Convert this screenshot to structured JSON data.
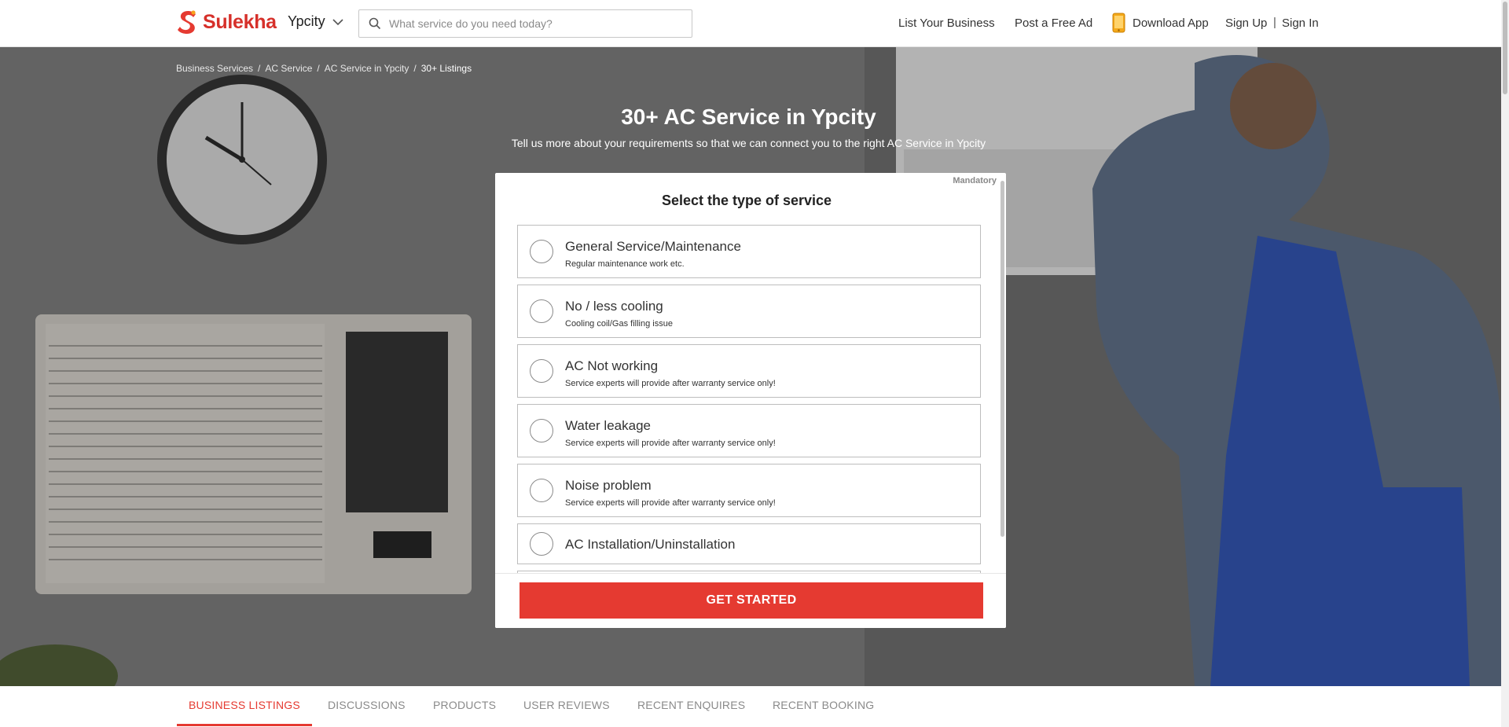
{
  "brand": {
    "name": "Sulekha",
    "accent": "#e53a31"
  },
  "header": {
    "city": "Ypcity",
    "search_placeholder": "What service do you need today?",
    "links": {
      "list_business": "List Your Business",
      "post_ad": "Post a Free Ad",
      "download_app": "Download App",
      "sign_up": "Sign Up",
      "separator": "|",
      "sign_in": "Sign In"
    }
  },
  "breadcrumb": [
    {
      "label": "Business Services"
    },
    {
      "label": "AC Service"
    },
    {
      "label": "AC Service in Ypcity"
    },
    {
      "label": "30+ Listings"
    }
  ],
  "breadcrumb_sep": "/",
  "hero": {
    "title": "30+ AC Service in Ypcity",
    "subtitle": "Tell us more about your requirements so that we can connect you to the right AC Service in Ypcity"
  },
  "form": {
    "mandatory": "Mandatory",
    "title": "Select the type of service",
    "options": [
      {
        "label": "General Service/Maintenance",
        "desc": "Regular maintenance work etc."
      },
      {
        "label": "No / less cooling",
        "desc": "Cooling coil/Gas filling issue"
      },
      {
        "label": "AC Not working",
        "desc": "Service experts will provide after warranty service only!"
      },
      {
        "label": "Water leakage",
        "desc": "Service experts will provide after warranty service only!"
      },
      {
        "label": "Noise problem",
        "desc": "Service experts will provide after warranty service only!"
      },
      {
        "label": "AC Installation/Uninstallation",
        "desc": ""
      }
    ],
    "cta": "GET STARTED"
  },
  "tabs": [
    {
      "label": "BUSINESS LISTINGS",
      "active": true
    },
    {
      "label": "DISCUSSIONS"
    },
    {
      "label": "PRODUCTS"
    },
    {
      "label": "USER REVIEWS"
    },
    {
      "label": "RECENT ENQUIRES"
    },
    {
      "label": "RECENT BOOKING"
    }
  ],
  "icons": {
    "logo": "sulekha-logo-icon",
    "city_dropdown": "chevron-down-icon",
    "search": "search-icon",
    "download": "phone-icon",
    "radio": "radio-icon"
  }
}
